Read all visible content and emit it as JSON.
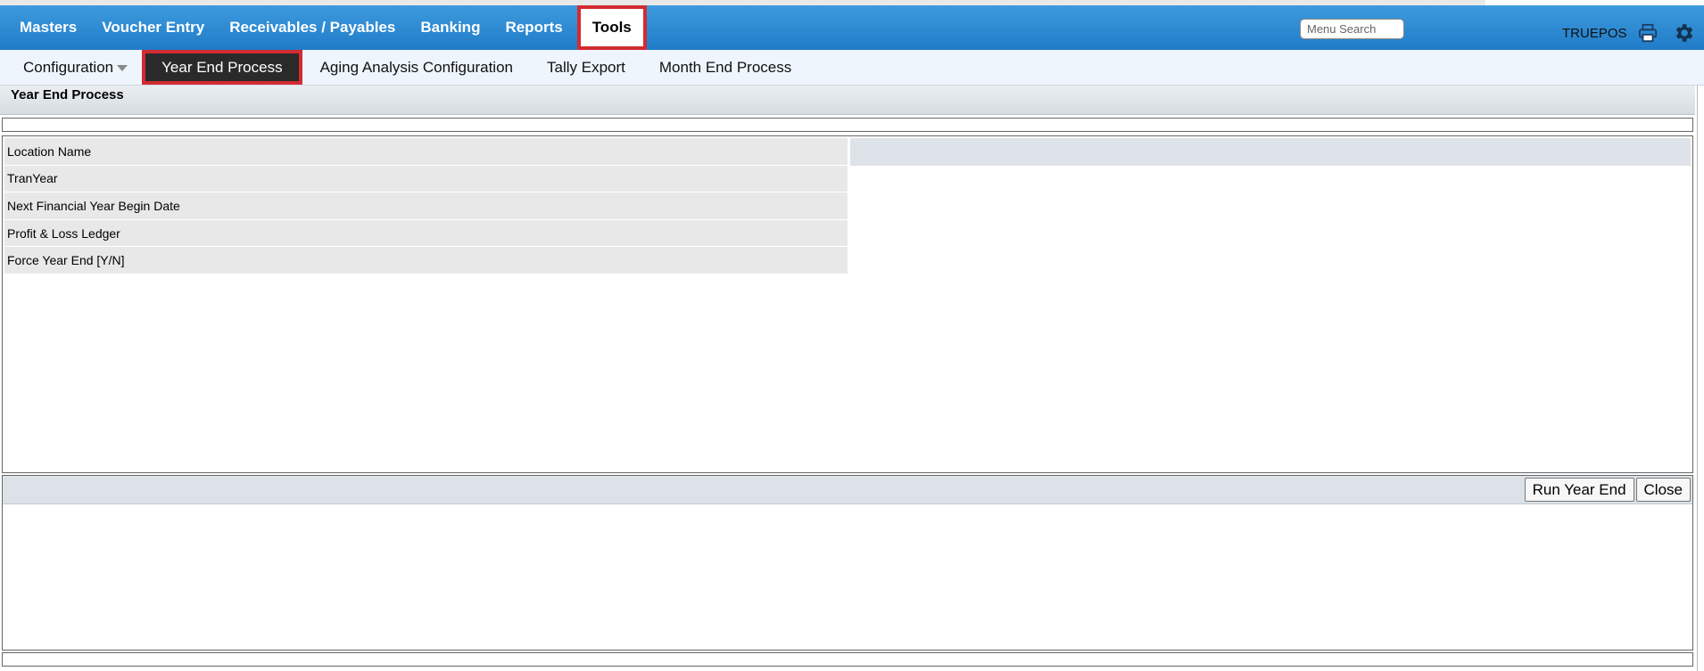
{
  "topnav": {
    "items": [
      {
        "label": "Masters"
      },
      {
        "label": "Voucher Entry"
      },
      {
        "label": "Receivables / Payables"
      },
      {
        "label": "Banking"
      },
      {
        "label": "Reports"
      },
      {
        "label": "Tools",
        "active": true
      }
    ],
    "search_placeholder": "Menu Search",
    "user": "TRUEPOS",
    "icons": [
      "print-icon",
      "gear-icon"
    ]
  },
  "subnav": {
    "items": [
      {
        "label": "Configuration",
        "has_dropdown": true
      },
      {
        "label": "Year End Process",
        "active": true
      },
      {
        "label": "Aging Analysis Configuration"
      },
      {
        "label": "Tally Export"
      },
      {
        "label": "Month End Process"
      }
    ]
  },
  "panel": {
    "title": "Year End Process",
    "fields": [
      {
        "label": "Location Name",
        "value": ""
      },
      {
        "label": "TranYear",
        "value": ""
      },
      {
        "label": "Next Financial Year Begin Date",
        "value": ""
      },
      {
        "label": "Profit & Loss Ledger",
        "value": ""
      },
      {
        "label": "Force Year End [Y/N]",
        "value": ""
      }
    ],
    "buttons": {
      "run": "Run Year End",
      "close": "Close"
    }
  },
  "colors": {
    "topbar": "#2b8ad3",
    "highlight": "#d22b32",
    "active_sub_bg": "#2a2a2a"
  }
}
